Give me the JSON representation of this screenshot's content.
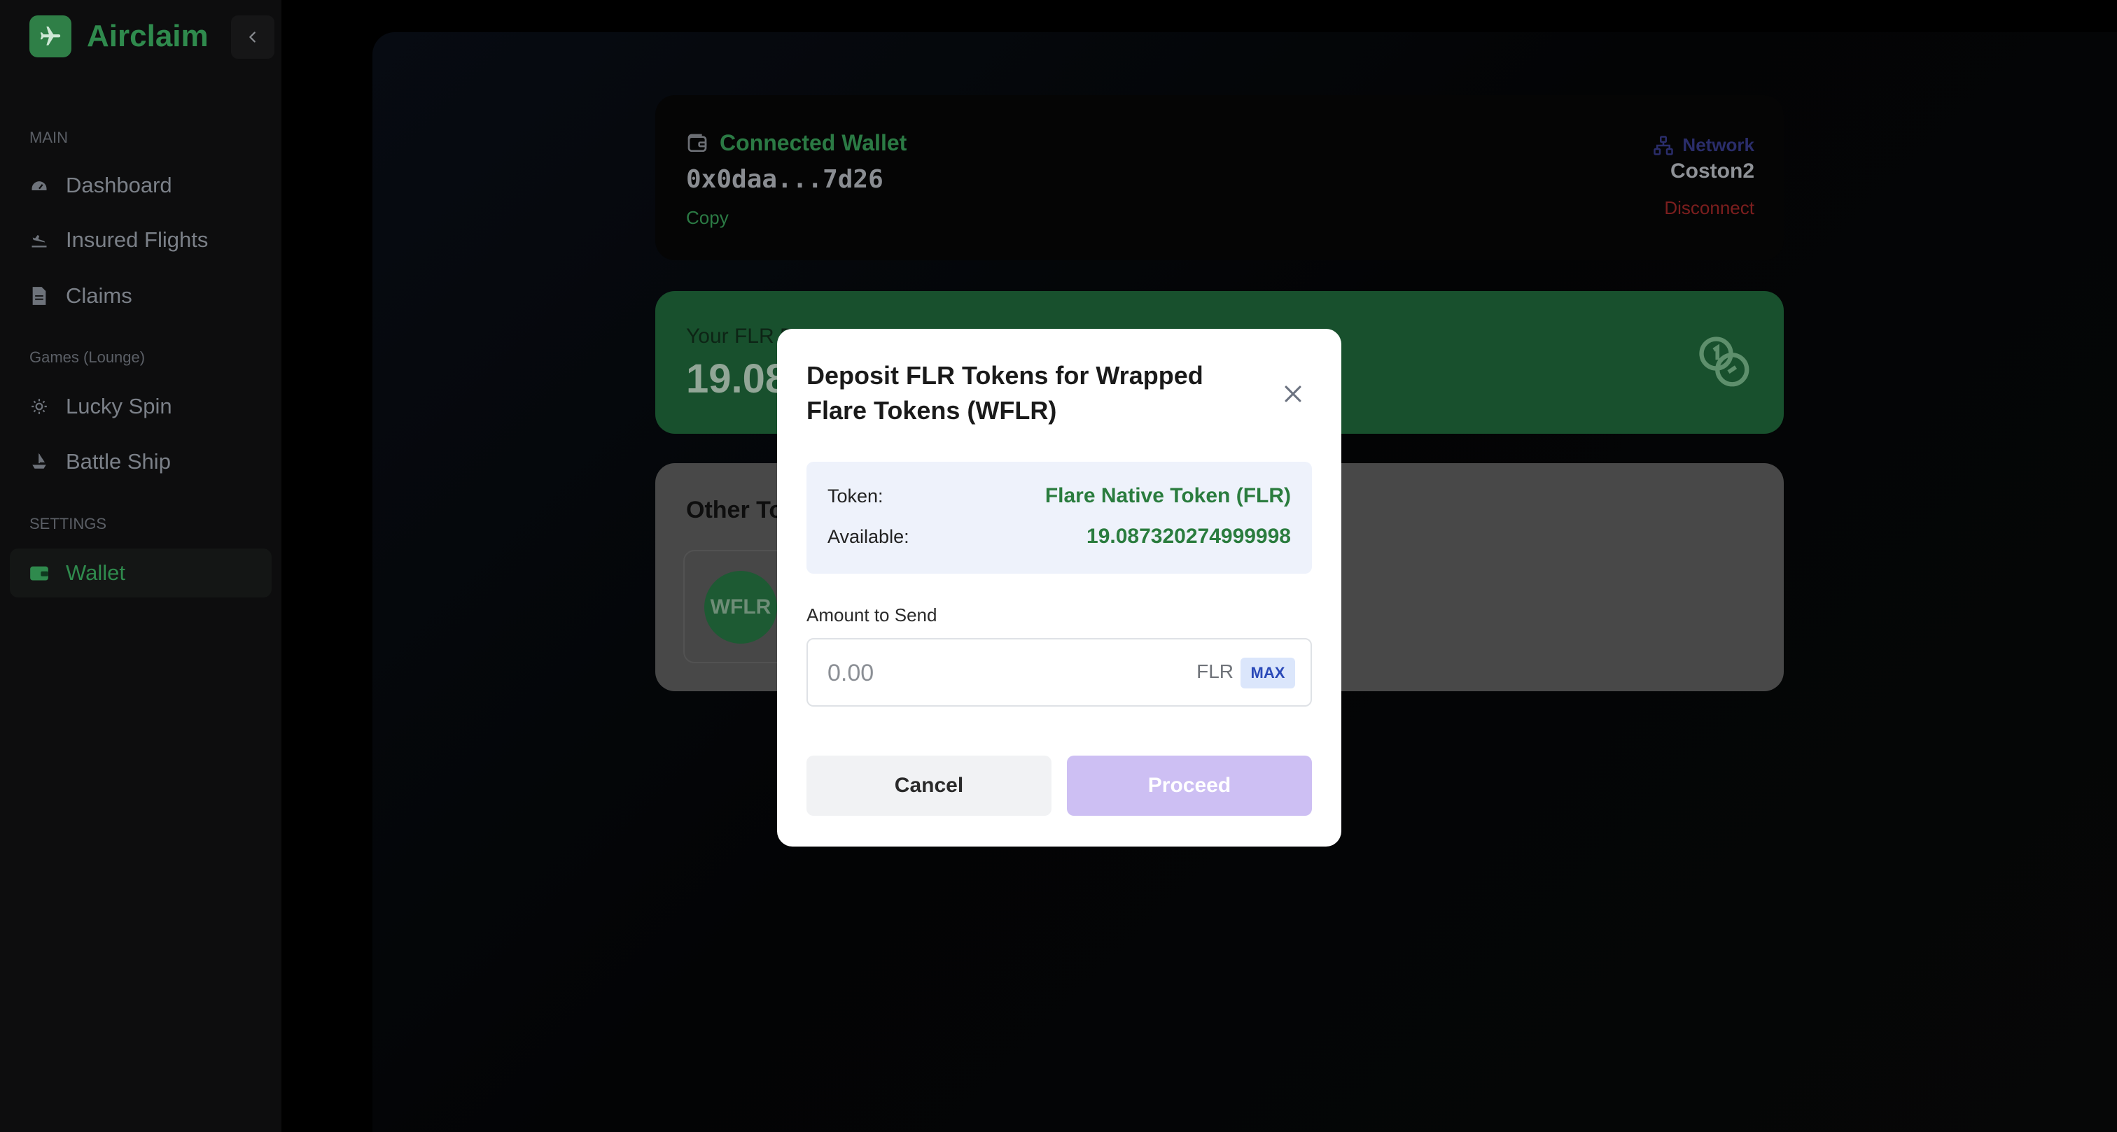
{
  "app": {
    "name": "Airclaim"
  },
  "sidebar": {
    "sections": [
      {
        "label": "MAIN",
        "items": [
          {
            "label": "Dashboard",
            "icon": "gauge-icon"
          },
          {
            "label": "Insured Flights",
            "icon": "plane-landing-icon"
          },
          {
            "label": "Claims",
            "icon": "document-icon"
          }
        ]
      },
      {
        "label": "Games (Lounge)",
        "items": [
          {
            "label": "Lucky Spin",
            "icon": "sun-icon"
          },
          {
            "label": "Battle Ship",
            "icon": "ship-icon"
          }
        ]
      },
      {
        "label": "SETTINGS",
        "items": [
          {
            "label": "Wallet",
            "icon": "wallet-icon",
            "active": true
          }
        ]
      }
    ]
  },
  "wallet": {
    "title": "Connected Wallet",
    "address": "0x0daa...7d26",
    "copy_label": "Copy",
    "network_label": "Network",
    "network_name": "Coston2",
    "disconnect_label": "Disconnect"
  },
  "balance": {
    "label": "Your FLR B",
    "value": "19.08"
  },
  "other_tokens": {
    "title": "Other To",
    "items": [
      {
        "symbol": "WFLR"
      }
    ]
  },
  "modal": {
    "title": "Deposit FLR Tokens for Wrapped Flare Tokens (WFLR)",
    "token_label": "Token:",
    "token_value": "Flare Native Token (FLR)",
    "available_label": "Available:",
    "available_value": "19.087320274999998",
    "amount_label": "Amount to Send",
    "amount_value": "",
    "amount_placeholder": "0.00",
    "amount_unit": "FLR",
    "max_label": "MAX",
    "cancel_label": "Cancel",
    "proceed_label": "Proceed"
  },
  "colors": {
    "brand_green": "#2f8a4d",
    "modal_accent_green": "#2a7c3e",
    "proceed_disabled": "#cdbff3",
    "disconnect_red": "#7c1e1e"
  }
}
